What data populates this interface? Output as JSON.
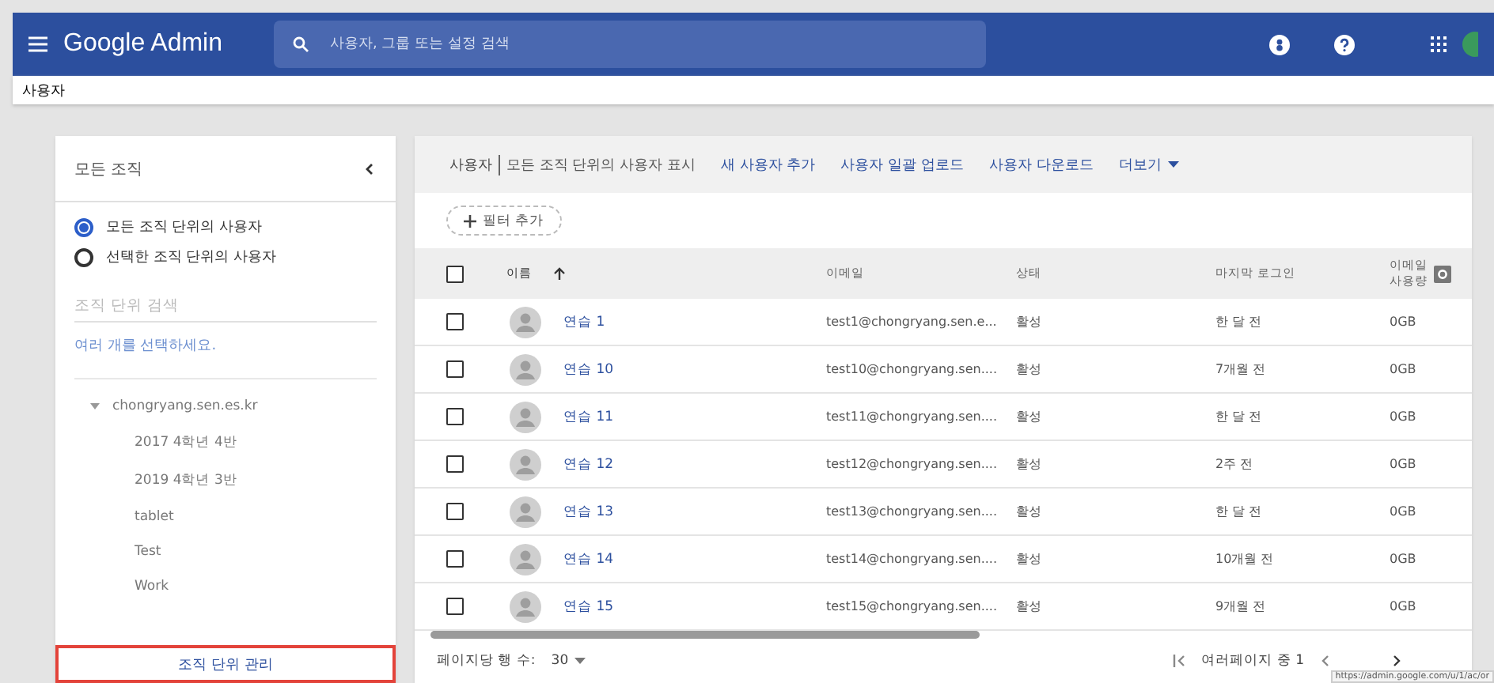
{
  "app_bar": {
    "title": "Google Admin",
    "search": {
      "placeholder": "사용자, 그룹 또는 설정 검색"
    }
  },
  "breadcrumb": "사용자",
  "sidebar": {
    "title": "모든 조직",
    "scope_options": [
      {
        "label": "모든 조직 단위의 사용자",
        "selected": true
      },
      {
        "label": "선택한 조직 단위의 사용자",
        "selected": false
      }
    ],
    "search": {
      "placeholder": "조직 단위 검색"
    },
    "multi_select_link": "여러 개를 선택하세요.",
    "tree": [
      {
        "label": "chongryang.sen.es.kr",
        "expanded": true,
        "children": [
          {
            "label": "2017 4학년 4반"
          },
          {
            "label": "2019 4학년 3반"
          },
          {
            "label": "tablet"
          },
          {
            "label": "Test"
          },
          {
            "label": "Work"
          }
        ]
      }
    ],
    "manage_button": "조직 단위 관리"
  },
  "users_panel": {
    "title": "사용자",
    "subtitle": "모든 조직 단위의 사용자 표시",
    "actions": [
      "새 사용자 추가",
      "사용자 일괄 업로드",
      "사용자 다운로드"
    ],
    "more": "더보기",
    "filter_button": "필터 추가",
    "table": {
      "select_all_checked": false,
      "columns": [
        "이름",
        "이메일",
        "상태",
        "마지막 로그인",
        "이메일 사용량"
      ],
      "rows": [
        {
          "name": "연습 1",
          "email": "test1@chongryang.sen.e...",
          "status": "활성",
          "last_login": "한 달 전",
          "usage": "0GB",
          "checked": false
        },
        {
          "name": "연습 10",
          "email": "test10@chongryang.sen....",
          "status": "활성",
          "last_login": "7개월 전",
          "usage": "0GB",
          "checked": false
        },
        {
          "name": "연습 11",
          "email": "test11@chongryang.sen....",
          "status": "활성",
          "last_login": "한 달 전",
          "usage": "0GB",
          "checked": false
        },
        {
          "name": "연습 12",
          "email": "test12@chongryang.sen....",
          "status": "활성",
          "last_login": "2주 전",
          "usage": "0GB",
          "checked": false
        },
        {
          "name": "연습 13",
          "email": "test13@chongryang.sen....",
          "status": "활성",
          "last_login": "한 달 전",
          "usage": "0GB",
          "checked": false
        },
        {
          "name": "연습 14",
          "email": "test14@chongryang.sen....",
          "status": "활성",
          "last_login": "10개월 전",
          "usage": "0GB",
          "checked": false
        },
        {
          "name": "연습 15",
          "email": "test15@chongryang.sen....",
          "status": "활성",
          "last_login": "9개월 전",
          "usage": "0GB",
          "checked": false
        }
      ]
    },
    "footer": {
      "rows_per_page_label": "페이지당 행 수:",
      "rows_per_page": "30",
      "page_info": "여러페이지 중 1"
    }
  },
  "status_url": "https://admin.google.com/u/1/ac/or"
}
